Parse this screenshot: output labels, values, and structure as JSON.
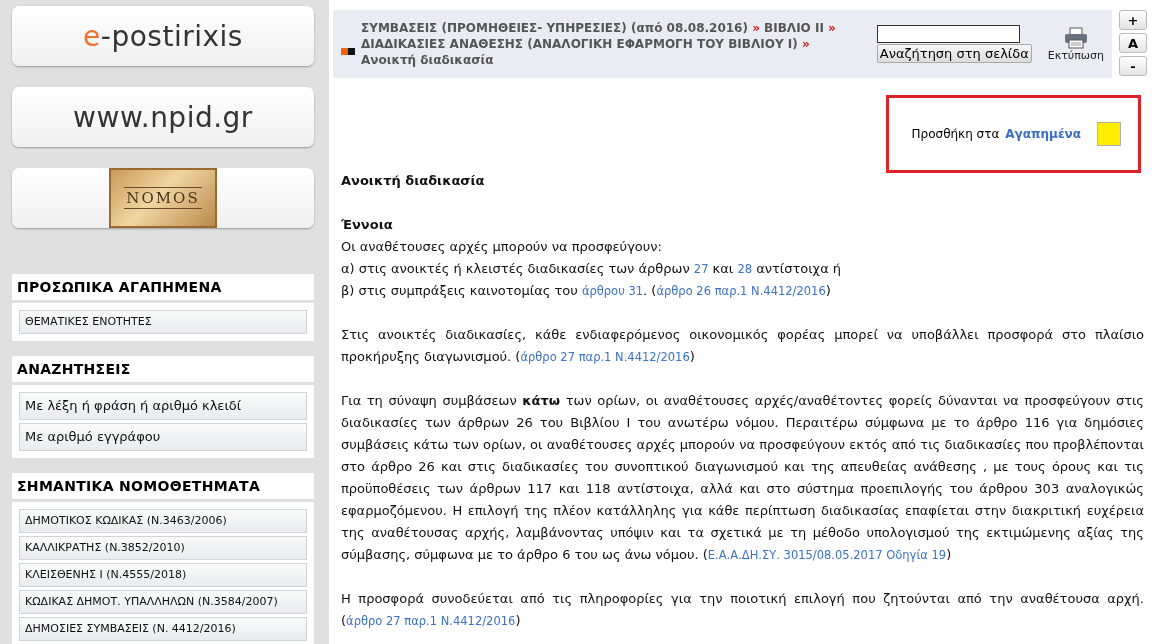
{
  "logo_buttons": [
    {
      "kind": "wordmark",
      "accent": "e",
      "text": "-postirixis"
    },
    {
      "kind": "wordmark",
      "text": "www.npid.gr"
    },
    {
      "kind": "plaque",
      "text": "NOMOS"
    }
  ],
  "sidebar_sections": [
    {
      "title": "ΠΡΟΣΩΠΙΚΑ ΑΓΑΠΗΜΕΝΑ",
      "kind": "small",
      "items": [
        "ΘΕΜΑΤΙΚΕΣ ΕΝΟΤΗΤΕΣ"
      ]
    },
    {
      "title": "ΑΝΑΖΗΤΗΣΕΙΣ",
      "kind": "large",
      "items": [
        "Με λέξη ή φράση ή αριθμό κλειδί",
        "Με αριθμό εγγράφου"
      ]
    },
    {
      "title": "ΣΗΜΑΝΤΙΚΑ ΝΟΜΟΘΕΤΗΜΑΤΑ",
      "kind": "small",
      "items": [
        "ΔΗΜΟΤΙΚΟΣ ΚΩΔΙΚΑΣ (Ν.3463/2006)",
        "ΚΑΛΛΙΚΡΑΤΗΣ (Ν.3852/2010)",
        "ΚΛΕΙΣΘΕΝΗΣ Ι (Ν.4555/2018)",
        "ΚΩΔΙΚΑΣ ΔΗΜΟΤ. ΥΠΑΛΛΗΛΩΝ (Ν.3584/2007)",
        "ΔΗΜΟΣΙΕΣ ΣΥΜΒΑΣΕΙΣ (Ν. 4412/2016)"
      ]
    }
  ],
  "breadcrumb": {
    "separator": "»",
    "items": [
      "ΣΥΜΒΑΣΕΙΣ (ΠΡΟΜΗΘΕΙΕΣ- ΥΠΗΡΕΣΙΕΣ) (από 08.08.2016)",
      "ΒΙΒΛΙΟ ΙΙ",
      "ΔΙΑΔΙΚΑΣΙΕΣ ΑΝΑΘΕΣΗΣ (ΑΝΑΛΟΓΙΚΗ ΕΦΑΡΜΟΓΗ ΤΟΥ ΒΙΒΛΙΟΥ Ι)",
      "Ανοικτή διαδικασία"
    ]
  },
  "search_button": "Αναζήτηση στη σελίδα",
  "print_label": "Εκτύπωση",
  "font_buttons": [
    "+",
    "A",
    "-"
  ],
  "favorite": {
    "text": "Προσθήκη στα",
    "link": "Αγαπημένα"
  },
  "article": {
    "title": "Ανοικτή διαδικασία",
    "heading": "Έννοια",
    "blocks": [
      [
        [
          {
            "kind": "text",
            "text": "Οι αναθέτουσες αρχές μπορούν να προσφεύγουν:"
          }
        ],
        [
          {
            "kind": "text",
            "text": "α) στις ανοικτές ή κλειστές διαδικασίες των άρθρων "
          },
          {
            "kind": "link",
            "text": "27"
          },
          {
            "kind": "text",
            "text": " και "
          },
          {
            "kind": "link",
            "text": "28"
          },
          {
            "kind": "text",
            "text": " αντίστοιχα ή"
          }
        ],
        [
          {
            "kind": "text",
            "text": "β) στις συμπράξεις καινοτομίας του "
          },
          {
            "kind": "link",
            "text": "άρθρου 31"
          },
          {
            "kind": "text",
            "text": ". ("
          },
          {
            "kind": "link",
            "text": "άρθρο 26 παρ.1 Ν.4412/2016"
          },
          {
            "kind": "text",
            "text": ")"
          }
        ]
      ],
      [
        [
          {
            "kind": "text",
            "text": "Στις ανοικτές διαδικασίες, κάθε ενδιαφερόμενος οικονομικός φορέας μπορεί να υποβάλλει προσφορά στο πλαίσιο προκήρυξης διαγωνισμού. ("
          },
          {
            "kind": "link",
            "text": "άρθρο 27 παρ.1 Ν.4412/2016"
          },
          {
            "kind": "text",
            "text": ")"
          }
        ]
      ],
      [
        [
          {
            "kind": "text",
            "text": "Για τη σύναψη συμβάσεων **κάτω** των ορίων, οι αναθέτουσες αρχές/αναθέτοντες φορείς δύνανται να προσφεύγουν στις διαδικασίες των άρθρων 26 του Βιβλίου Ι του ανωτέρω νόμου. Περαιτέρω σύμφωνα με το άρθρο 116 για δημόσιες συμβάσεις κάτω των ορίων, οι αναθέτουσες αρχές μπορούν να προσφεύγουν εκτός από τις διαδικασίες που προβλέπονται στο άρθρο 26 και στις διαδικασίες του συνοπτικού διαγωνισμού και της απευθείας ανάθεσης , με τους όρους και τις προϋποθέσεις των άρθρων 117 και 118 αντίστοιχα, αλλά και στο σύστημα προεπιλογής του άρθρου 303 αναλογικώς εφαρμοζόμενου. Η επιλογή της πλέον κατάλληλης για κάθε περίπτωση διαδικασίας επαφίεται στην διακριτική ευχέρεια της αναθέτουσας αρχής, λαμβάνοντας υπόψιν και τα σχετικά με τη μέθοδο υπολογισμού της εκτιμώμενης αξίας της σύμβασης, σύμφωνα με το άρθρο 6 του ως άνω νόμου. ("
          },
          {
            "kind": "link",
            "text": "Ε.Α.Α.ΔΗ.ΣΥ. 3015/08.05.2017 Οδηγία 19"
          },
          {
            "kind": "text",
            "text": ")"
          }
        ]
      ],
      [
        [
          {
            "kind": "text",
            "text": "Η προσφορά συνοδεύεται από τις πληροφορίες για την ποιοτική επιλογή που ζητούνται από την αναθέτουσα αρχή. ("
          },
          {
            "kind": "link",
            "text": "άρθρο 27 παρ.1 Ν.4412/2016"
          },
          {
            "kind": "text",
            "text": ")"
          }
        ]
      ]
    ]
  }
}
